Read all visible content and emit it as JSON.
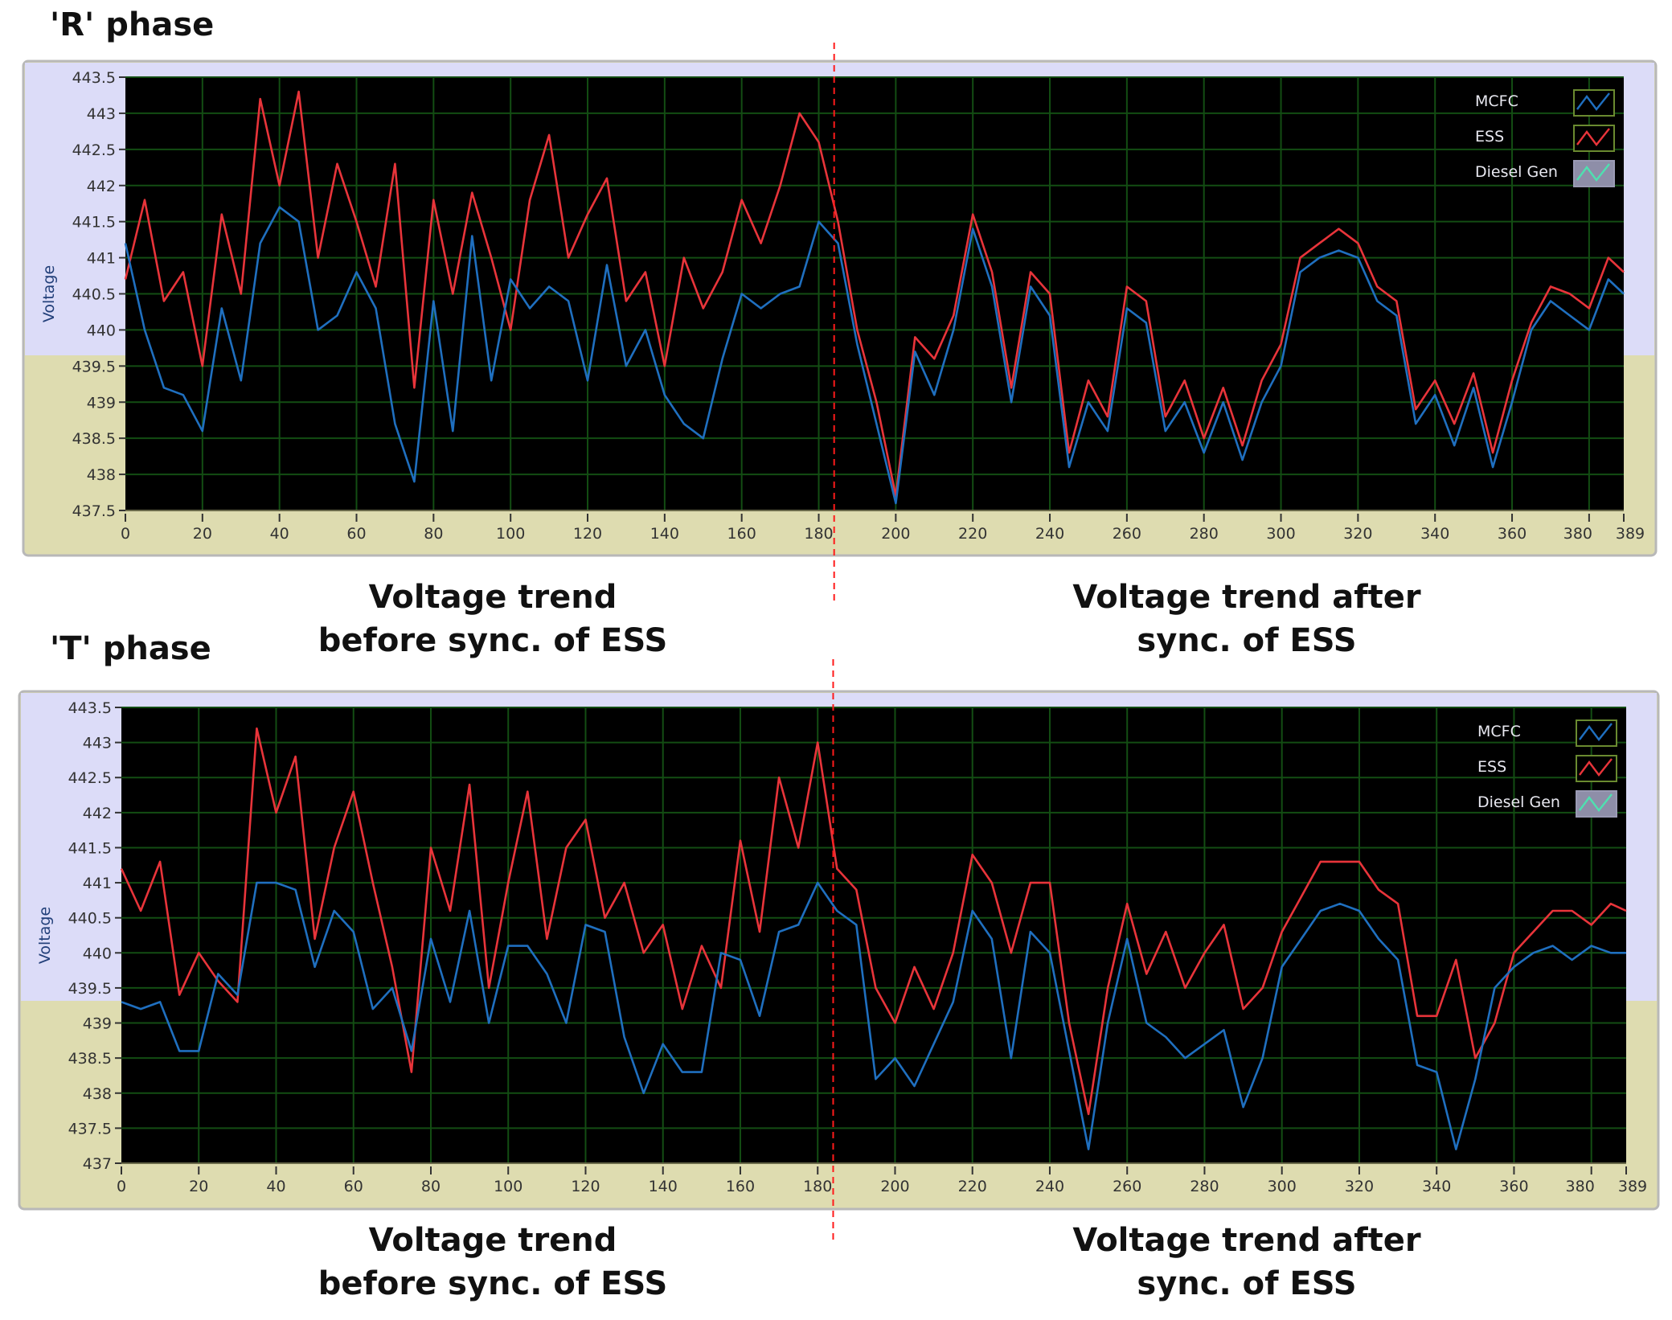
{
  "colors": {
    "mcfc": "#1f6fbf",
    "ess": "#e8343a",
    "diesel": "#4fe0b0",
    "plot_bg": "#000000",
    "grid": "#134d13",
    "panel_top": "#dcdcf8",
    "panel_bottom": "#dedcb0",
    "sync_line": "#ff1a1a"
  },
  "captions": {
    "before": [
      "Voltage trend",
      "before sync. of ESS"
    ],
    "after": [
      "Voltage trend after",
      "sync. of ESS"
    ]
  },
  "chart_data": [
    {
      "type": "line",
      "title": "'R' phase",
      "ylabel": "Voltage",
      "xlabel": "",
      "xlim": [
        0,
        389
      ],
      "ylim": [
        437.5,
        443.5
      ],
      "grid": true,
      "legend": "top-right",
      "xticks": [
        0,
        20,
        40,
        60,
        80,
        100,
        120,
        140,
        160,
        180,
        200,
        220,
        240,
        260,
        280,
        300,
        320,
        340,
        360,
        380,
        389
      ],
      "yticks": [
        437.5,
        438,
        438.5,
        439,
        439.5,
        440,
        440.5,
        441,
        441.5,
        442,
        442.5,
        443,
        443.5
      ],
      "sync_x": 184,
      "legend_entries": [
        "MCFC",
        "ESS",
        "Diesel Gen"
      ],
      "x": [
        0,
        5,
        10,
        15,
        20,
        25,
        30,
        35,
        40,
        45,
        50,
        55,
        60,
        65,
        70,
        75,
        80,
        85,
        90,
        95,
        100,
        105,
        110,
        115,
        120,
        125,
        130,
        135,
        140,
        145,
        150,
        155,
        160,
        165,
        170,
        175,
        180,
        185,
        190,
        195,
        200,
        205,
        210,
        215,
        220,
        225,
        230,
        235,
        240,
        245,
        250,
        255,
        260,
        265,
        270,
        275,
        280,
        285,
        290,
        295,
        300,
        305,
        310,
        315,
        320,
        325,
        330,
        335,
        340,
        345,
        350,
        355,
        360,
        365,
        370,
        375,
        380,
        385,
        389
      ],
      "series": [
        {
          "name": "ESS",
          "values": [
            440.7,
            441.8,
            440.4,
            440.8,
            439.5,
            441.6,
            440.5,
            443.2,
            442.0,
            443.3,
            441.0,
            442.3,
            441.5,
            440.6,
            442.3,
            439.2,
            441.8,
            440.5,
            441.9,
            441.0,
            440.0,
            441.8,
            442.7,
            441.0,
            441.6,
            442.1,
            440.4,
            440.8,
            439.5,
            441.0,
            440.3,
            440.8,
            441.8,
            441.2,
            442.0,
            443.0,
            442.6,
            441.5,
            440.0,
            439.0,
            437.7,
            439.9,
            439.6,
            440.2,
            441.6,
            440.8,
            439.2,
            440.8,
            440.5,
            438.3,
            439.3,
            438.8,
            440.6,
            440.4,
            438.8,
            439.3,
            438.5,
            439.2,
            438.4,
            439.3,
            439.8,
            441.0,
            441.2,
            441.4,
            441.2,
            440.6,
            440.4,
            438.9,
            439.3,
            438.7,
            439.4,
            438.3,
            439.3,
            440.1,
            440.6,
            440.5,
            440.3,
            441.0,
            440.8
          ]
        },
        {
          "name": "MCFC",
          "values": [
            441.2,
            440.0,
            439.2,
            439.1,
            438.6,
            440.3,
            439.3,
            441.2,
            441.7,
            441.5,
            440.0,
            440.2,
            440.8,
            440.3,
            438.7,
            437.9,
            440.4,
            438.6,
            441.3,
            439.3,
            440.7,
            440.3,
            440.6,
            440.4,
            439.3,
            440.9,
            439.5,
            440.0,
            439.1,
            438.7,
            438.5,
            439.6,
            440.5,
            440.3,
            440.5,
            440.6,
            441.5,
            441.2,
            439.8,
            438.7,
            437.6,
            439.7,
            439.1,
            440.0,
            441.4,
            440.6,
            439.0,
            440.6,
            440.2,
            438.1,
            439.0,
            438.6,
            440.3,
            440.1,
            438.6,
            439.0,
            438.3,
            439.0,
            438.2,
            439.0,
            439.5,
            440.8,
            441.0,
            441.1,
            441.0,
            440.4,
            440.2,
            438.7,
            439.1,
            438.4,
            439.2,
            438.1,
            439.0,
            440.0,
            440.4,
            440.2,
            440.0,
            440.7,
            440.5
          ]
        }
      ]
    },
    {
      "type": "line",
      "title": "'T' phase",
      "ylabel": "Voltage",
      "xlabel": "",
      "xlim": [
        0,
        389
      ],
      "ylim": [
        437,
        443.5
      ],
      "grid": true,
      "legend": "top-right",
      "xticks": [
        0,
        20,
        40,
        60,
        80,
        100,
        120,
        140,
        160,
        180,
        200,
        220,
        240,
        260,
        280,
        300,
        320,
        340,
        360,
        380,
        389
      ],
      "yticks": [
        437,
        437.5,
        438,
        438.5,
        439,
        439.5,
        440,
        440.5,
        441,
        441.5,
        442,
        442.5,
        443,
        443.5
      ],
      "sync_x": 184,
      "legend_entries": [
        "MCFC",
        "ESS",
        "Diesel Gen"
      ],
      "x": [
        0,
        5,
        10,
        15,
        20,
        25,
        30,
        35,
        40,
        45,
        50,
        55,
        60,
        65,
        70,
        75,
        80,
        85,
        90,
        95,
        100,
        105,
        110,
        115,
        120,
        125,
        130,
        135,
        140,
        145,
        150,
        155,
        160,
        165,
        170,
        175,
        180,
        185,
        190,
        195,
        200,
        205,
        210,
        215,
        220,
        225,
        230,
        235,
        240,
        245,
        250,
        255,
        260,
        265,
        270,
        275,
        280,
        285,
        290,
        295,
        300,
        305,
        310,
        315,
        320,
        325,
        330,
        335,
        340,
        345,
        350,
        355,
        360,
        365,
        370,
        375,
        380,
        385,
        389
      ],
      "series": [
        {
          "name": "ESS",
          "values": [
            441.2,
            440.6,
            441.3,
            439.4,
            440.0,
            439.6,
            439.3,
            443.2,
            442.0,
            442.8,
            440.2,
            441.5,
            442.3,
            441.0,
            439.8,
            438.3,
            441.5,
            440.6,
            442.4,
            439.5,
            441.0,
            442.3,
            440.2,
            441.5,
            441.9,
            440.5,
            441.0,
            440.0,
            440.4,
            439.2,
            440.1,
            439.5,
            441.6,
            440.3,
            442.5,
            441.5,
            443.0,
            441.2,
            440.9,
            439.5,
            439.0,
            439.8,
            439.2,
            440.0,
            441.4,
            441.0,
            440.0,
            441.0,
            441.0,
            439.0,
            437.7,
            439.5,
            440.7,
            439.7,
            440.3,
            439.5,
            440.0,
            440.4,
            439.2,
            439.5,
            440.3,
            440.8,
            441.3,
            441.3,
            441.3,
            440.9,
            440.7,
            439.1,
            439.1,
            439.9,
            438.5,
            439.0,
            440.0,
            440.3,
            440.6,
            440.6,
            440.4,
            440.7,
            440.6
          ]
        },
        {
          "name": "MCFC",
          "values": [
            439.3,
            439.2,
            439.3,
            438.6,
            438.6,
            439.7,
            439.4,
            441.0,
            441.0,
            440.9,
            439.8,
            440.6,
            440.3,
            439.2,
            439.5,
            438.6,
            440.2,
            439.3,
            440.6,
            439.0,
            440.1,
            440.1,
            439.7,
            439.0,
            440.4,
            440.3,
            438.8,
            438.0,
            438.7,
            438.3,
            438.3,
            440.0,
            439.9,
            439.1,
            440.3,
            440.4,
            441.0,
            440.6,
            440.4,
            438.2,
            438.5,
            438.1,
            438.7,
            439.3,
            440.6,
            440.2,
            438.5,
            440.3,
            440.0,
            438.6,
            437.2,
            439.0,
            440.2,
            439.0,
            438.8,
            438.5,
            438.7,
            438.9,
            437.8,
            438.5,
            439.8,
            440.2,
            440.6,
            440.7,
            440.6,
            440.2,
            439.9,
            438.4,
            438.3,
            437.2,
            438.2,
            439.5,
            439.8,
            440.0,
            440.1,
            439.9,
            440.1,
            440.0,
            440.0
          ]
        }
      ]
    }
  ]
}
